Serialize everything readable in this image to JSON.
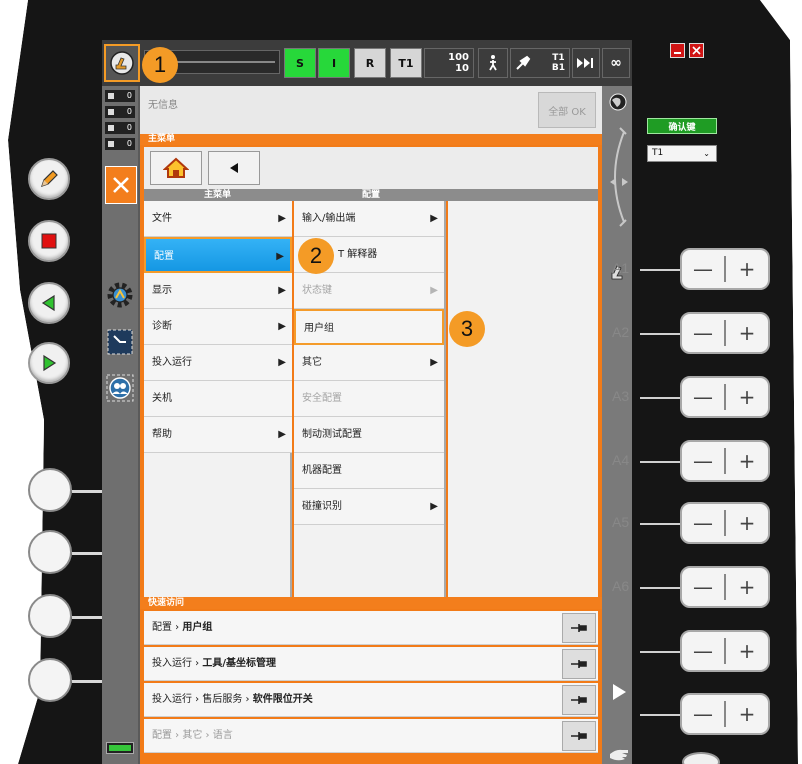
{
  "status_bar": {
    "s_label": "S",
    "i_label": "I",
    "r_label": "R",
    "mode_label": "T1",
    "override_top": "100",
    "override_bottom": "10",
    "tool_top": "T1",
    "tool_bottom": "B1",
    "infinity_label": "∞"
  },
  "counters": [
    "0",
    "0",
    "0",
    "0"
  ],
  "messages": {
    "text": "无信息",
    "ack_all_label": "全部 OK"
  },
  "main_menu": {
    "header": "主菜单",
    "col1_title": "主菜单",
    "col2_title": "配置",
    "items": [
      {
        "label": "文件",
        "submenu": true
      },
      {
        "label": "配置",
        "submenu": true,
        "selected": true
      },
      {
        "label": "显示",
        "submenu": true
      },
      {
        "label": "诊断",
        "submenu": true
      },
      {
        "label": "投入运行",
        "submenu": true
      },
      {
        "label": "关机",
        "submenu": false
      },
      {
        "label": "帮助",
        "submenu": true
      }
    ],
    "sub_items": [
      {
        "label": "输入/输出端",
        "submenu": true,
        "disabled": false
      },
      {
        "label": "T 解释器",
        "submenu": false,
        "disabled": false
      },
      {
        "label": "状态键",
        "submenu": true,
        "disabled": true
      },
      {
        "label": "用户组",
        "submenu": false,
        "disabled": false,
        "highlight": true
      },
      {
        "label": "其它",
        "submenu": true,
        "disabled": false
      },
      {
        "label": "安全配置",
        "submenu": false,
        "disabled": true
      },
      {
        "label": "制动测试配置",
        "submenu": false,
        "disabled": false
      },
      {
        "label": "机器配置",
        "submenu": false,
        "disabled": false
      },
      {
        "label": "碰撞识别",
        "submenu": true,
        "disabled": false
      }
    ]
  },
  "quick_access": {
    "header": "快速访问",
    "items": [
      {
        "path": "配置",
        "target": "用户组",
        "disabled": false
      },
      {
        "path": "投入运行",
        "target": "工具/基坐标管理",
        "disabled": false
      },
      {
        "path": "投入运行 › 售后服务",
        "target": "软件限位开关",
        "disabled": false
      },
      {
        "path": "配置 › 其它",
        "target": "语言",
        "disabled": true
      }
    ]
  },
  "right_panel": {
    "enable_label": "确认键",
    "mode_value": "T1",
    "axes": [
      "A1",
      "A2",
      "A3",
      "A4",
      "A5",
      "A6"
    ]
  },
  "callouts": [
    "1",
    "2",
    "3"
  ],
  "colors": {
    "accent_orange": "#f27b18",
    "selected_blue": "#1f9fe8",
    "status_green": "#27d83a",
    "enable_green": "#1f9c24",
    "close_red": "#d01414"
  },
  "icons": [
    "pencil-icon",
    "stop-icon",
    "play-backward-icon",
    "play-forward-icon",
    "home-icon",
    "back-arrow-icon",
    "robot-icon",
    "close-icon",
    "settings-gear-icon",
    "globe-icon",
    "pin-icon"
  ]
}
